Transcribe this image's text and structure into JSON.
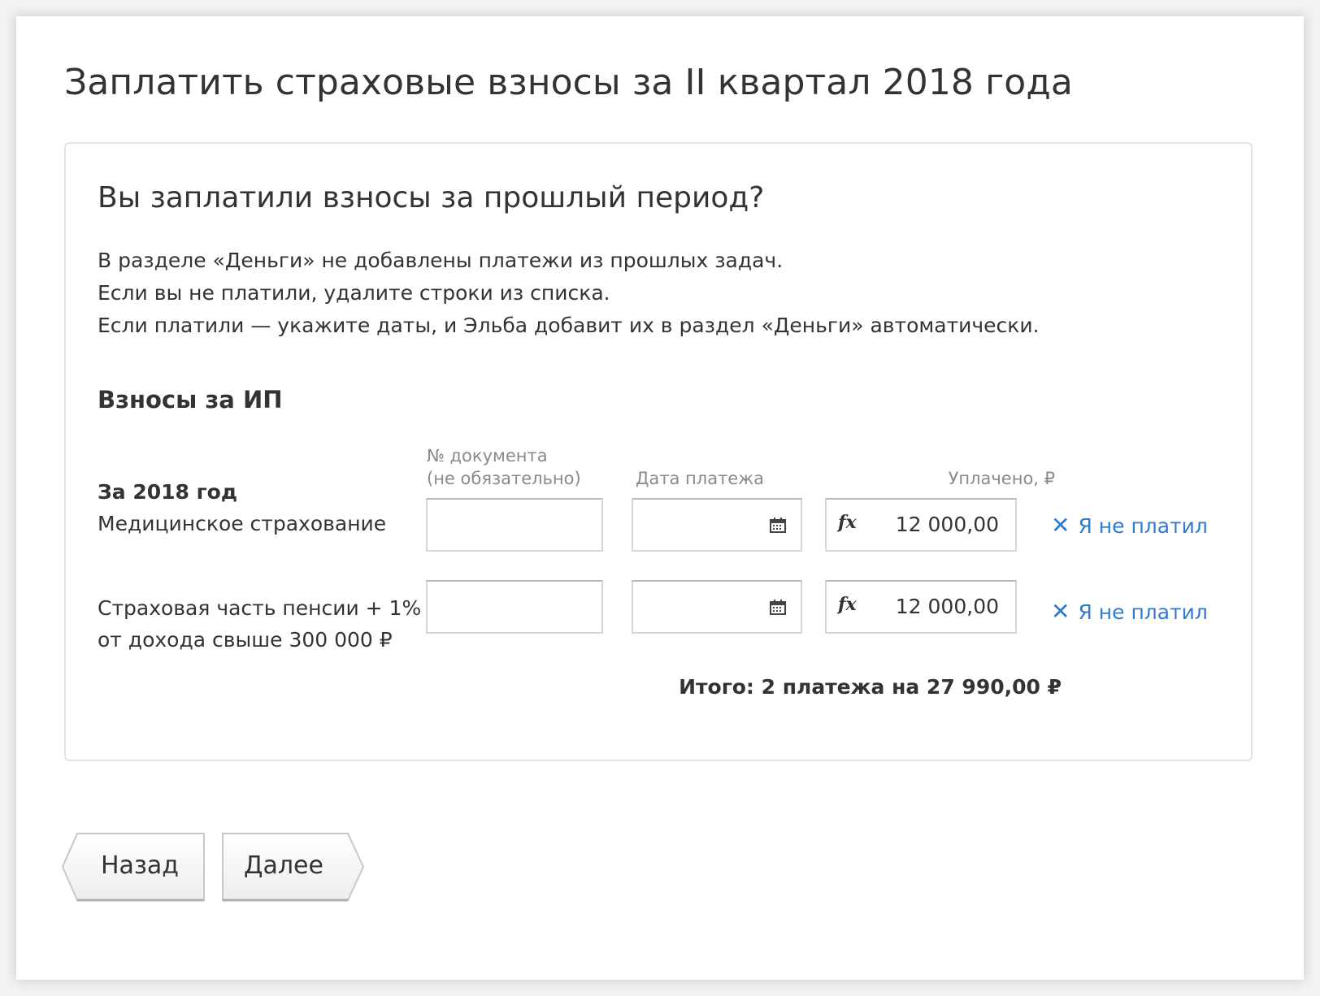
{
  "page": {
    "title": "Заплатить страховые взносы за II квартал 2018 года"
  },
  "card": {
    "title": "Вы заплатили взносы за прошлый период?",
    "intro": [
      "В разделе «Деньги» не добавлены платежи из прошлых задач.",
      "Если вы не платили, удалите строки из списка.",
      "Если платили — укажите даты, и Эльба добавит их в раздел «Деньги» автоматически."
    ]
  },
  "section": {
    "title": "Взносы за ИП",
    "year_label": "За 2018 год",
    "columns": {
      "doc_line1": "№ документа",
      "doc_line2": "(не обязательно)",
      "date": "Дата платежа",
      "paid": "Уплачено, ₽"
    },
    "rows": [
      {
        "label_lines": [
          "Медицинское страхование"
        ],
        "doc_number": "",
        "payment_date": "",
        "amount": "12 000,00",
        "not_paid_label": "Я не платил"
      },
      {
        "label_lines": [
          "Страховая часть пенсии + 1%",
          "от дохода свыше 300 000 ₽"
        ],
        "doc_number": "",
        "payment_date": "",
        "amount": "12 000,00",
        "not_paid_label": "Я не платил"
      }
    ],
    "total": "Итого: 2 платежа на 27 990,00 ₽"
  },
  "icons": {
    "calendar": "calendar-icon",
    "formula": "fx-icon",
    "remove": "close-icon",
    "formula_glyph": "fx",
    "remove_glyph": "✕"
  },
  "nav": {
    "back_label": "Назад",
    "next_label": "Далее"
  },
  "colors": {
    "link": "#2f7bd1",
    "text": "#333333",
    "muted": "#8a8a8a",
    "border": "#e3e3e3"
  }
}
